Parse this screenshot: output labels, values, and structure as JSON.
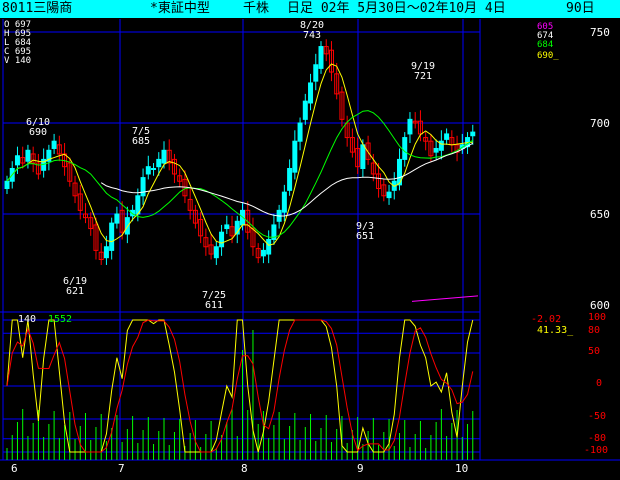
{
  "title_bar": {
    "code_name": "8011三陽商",
    "market": "*東証中型",
    "unit": "千株",
    "period": "日足 02年 5月30日～02年10月 4日",
    "days": "90日"
  },
  "ohlcv": [
    {
      "key": "O",
      "value": "697"
    },
    {
      "key": "H",
      "value": "695"
    },
    {
      "key": "L",
      "value": "684"
    },
    {
      "key": "C",
      "value": "695"
    },
    {
      "key": "V",
      "value": "140"
    }
  ],
  "legend_values": [
    {
      "value": "605",
      "color": "#ff00ff"
    },
    {
      "value": "674",
      "color": "#ffffff"
    },
    {
      "value": "684",
      "color": "#00ff00"
    },
    {
      "value": "690_",
      "color": "#ffff00"
    }
  ],
  "indicator_header": {
    "volume": "140",
    "value2": "1552",
    "red_value": "-2.02",
    "yellow_value": "41.33_"
  },
  "colors": {
    "background": "#000000",
    "title_bar": "#00ffff",
    "grid": "#0000ff",
    "candle_up": "#00ffff",
    "candle_down": "#ff0000",
    "ma_short": "#ffff00",
    "ma_mid": "#00ff00",
    "ma_long": "#ffffff",
    "ma_extra": "#ff00ff",
    "volume": "#00ff00",
    "osc_fast": "#ffff00",
    "osc_slow": "#ff0000"
  },
  "annotations": [
    {
      "date": "6/10",
      "price": "690"
    },
    {
      "date": "6/19",
      "price": "621"
    },
    {
      "date": "7/5",
      "price": "685"
    },
    {
      "date": "7/25",
      "price": "611"
    },
    {
      "date": "8/20",
      "price": "743"
    },
    {
      "date": "9/3",
      "price": "651"
    },
    {
      "date": "9/19",
      "price": "721"
    }
  ],
  "chart_data": {
    "type": "candlestick",
    "price_axis": {
      "ticks": [
        600,
        650,
        700,
        750
      ],
      "ylim": [
        600,
        752
      ]
    },
    "oscillator_axis": {
      "ticks": [
        "100",
        "80",
        "50",
        "0",
        "-50",
        "-80",
        "-100"
      ],
      "ylim": [
        -100,
        100
      ]
    },
    "x_ticks": [
      "6",
      "7",
      "8",
      "9",
      "10"
    ],
    "series": [
      {
        "name": "candles",
        "close": [
          668,
          675,
          682,
          678,
          685,
          678,
          672,
          680,
          685,
          690,
          683,
          676,
          668,
          660,
          652,
          648,
          642,
          630,
          625,
          632,
          645,
          650,
          640,
          648,
          652,
          660,
          670,
          676,
          675,
          680,
          685,
          678,
          672,
          668,
          660,
          652,
          645,
          638,
          632,
          628,
          632,
          640,
          644,
          638,
          646,
          652,
          640,
          632,
          626,
          630,
          636,
          644,
          652,
          662,
          675,
          690,
          700,
          712,
          722,
          732,
          742,
          738,
          728,
          716,
          702,
          692,
          684,
          676,
          688,
          680,
          672,
          664,
          660,
          662,
          668,
          680,
          692,
          702,
          700,
          694,
          690,
          682,
          686,
          690,
          694,
          688,
          684,
          688,
          692,
          695
        ]
      }
    ]
  }
}
